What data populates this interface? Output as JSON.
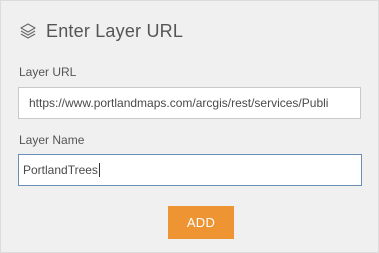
{
  "header": {
    "icon": "layers-icon",
    "title": "Enter Layer URL"
  },
  "form": {
    "url_label": "Layer URL",
    "url_value": "https://www.portlandmaps.com/arcgis/rest/services/Publi",
    "name_label": "Layer Name",
    "name_value": "PortlandTrees"
  },
  "actions": {
    "add_label": "ADD"
  },
  "colors": {
    "panel_background": "#f0f0f0",
    "accent": "#ee9432",
    "focus_border": "#6a8fb5"
  }
}
